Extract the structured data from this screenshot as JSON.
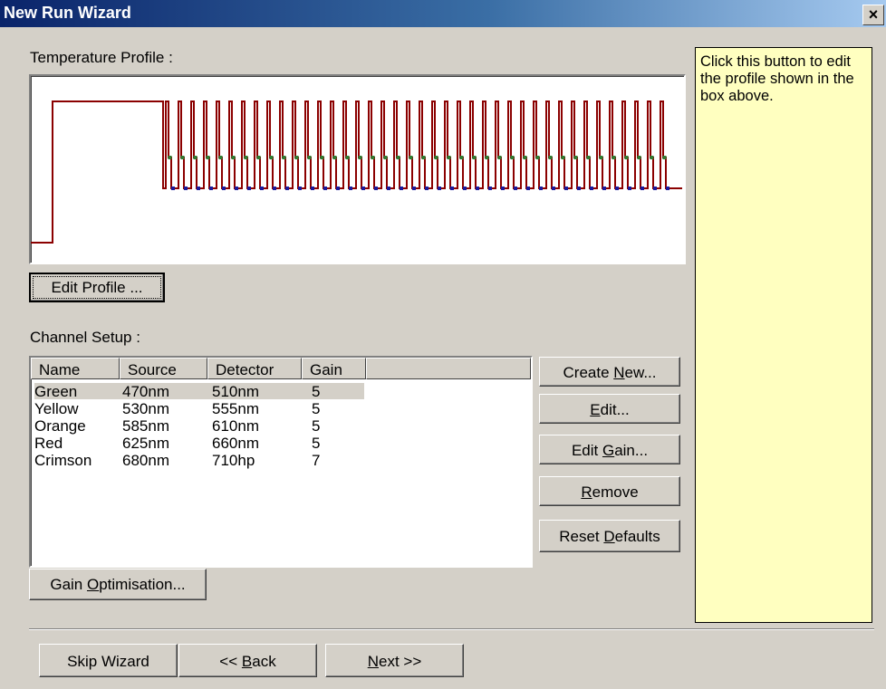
{
  "window": {
    "title": "New Run Wizard",
    "close_glyph": "×"
  },
  "profile": {
    "label": "Temperature Profile :",
    "edit_button": "Edit Profile ..."
  },
  "help_text": "Click this button to edit the profile shown in the box above.",
  "channel": {
    "label": "Channel Setup :",
    "columns": [
      "Name",
      "Source",
      "Detector",
      "Gain"
    ],
    "rows": [
      {
        "name": "Green",
        "source": "470nm",
        "detector": "510nm",
        "gain": "5"
      },
      {
        "name": "Yellow",
        "source": "530nm",
        "detector": "555nm",
        "gain": "5"
      },
      {
        "name": "Orange",
        "source": "585nm",
        "detector": "610nm",
        "gain": "5"
      },
      {
        "name": "Red",
        "source": "625nm",
        "detector": "660nm",
        "gain": "5"
      },
      {
        "name": "Crimson",
        "source": "680nm",
        "detector": "710hp",
        "gain": "7"
      }
    ],
    "buttons": {
      "create_new": {
        "pre": "Create ",
        "u": "N",
        "post": "ew..."
      },
      "edit": {
        "pre": "",
        "u": "E",
        "post": "dit..."
      },
      "edit_gain": {
        "pre": "Edit ",
        "u": "G",
        "post": "ain..."
      },
      "remove": {
        "pre": "",
        "u": "R",
        "post": "emove"
      },
      "reset": {
        "pre": "Reset ",
        "u": "D",
        "post": "efaults"
      }
    },
    "gain_opt": {
      "pre": "Gain ",
      "u": "O",
      "post": "ptimisation..."
    }
  },
  "footer": {
    "skip": "Skip Wizard",
    "back": {
      "pre": "<< ",
      "u": "B",
      "post": "ack"
    },
    "next": {
      "pre": "",
      "u": "N",
      "post": "ext >>"
    }
  },
  "colors": {
    "profile_line": "#8b0000",
    "marker_green": "#2e7d32",
    "marker_blue": "#1a1a9c",
    "help_bg": "#ffffc0"
  }
}
